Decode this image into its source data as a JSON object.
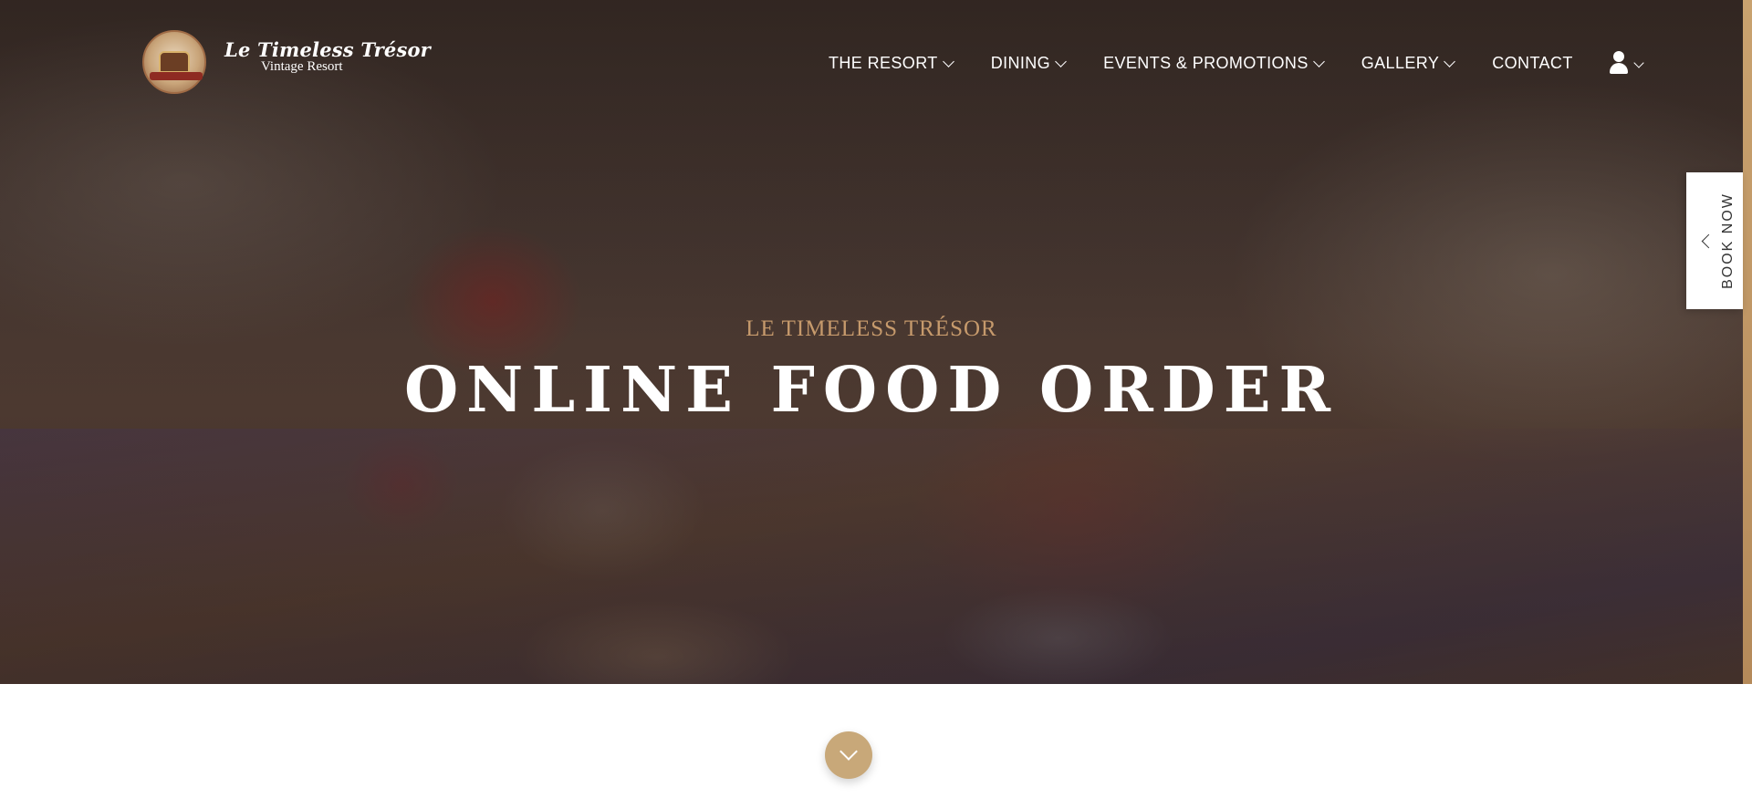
{
  "brand": {
    "name": "Le Timeless Trésor",
    "tagline": "Vintage Resort"
  },
  "nav": {
    "items": [
      {
        "label": "THE RESORT",
        "has_dropdown": true
      },
      {
        "label": "DINING",
        "has_dropdown": true
      },
      {
        "label": "EVENTS & PROMOTIONS",
        "has_dropdown": true
      },
      {
        "label": "GALLERY",
        "has_dropdown": true
      },
      {
        "label": "CONTACT",
        "has_dropdown": false
      }
    ],
    "account_icon": "user-icon"
  },
  "hero": {
    "kicker": "LE TIMELESS TRÉSOR",
    "title": "ONLINE FOOD ORDER"
  },
  "book_now": {
    "label": "BOOK NOW"
  },
  "colors": {
    "accent_gold": "#c8a879",
    "kicker_gold": "#c69a6c",
    "text_white": "#ffffff"
  }
}
